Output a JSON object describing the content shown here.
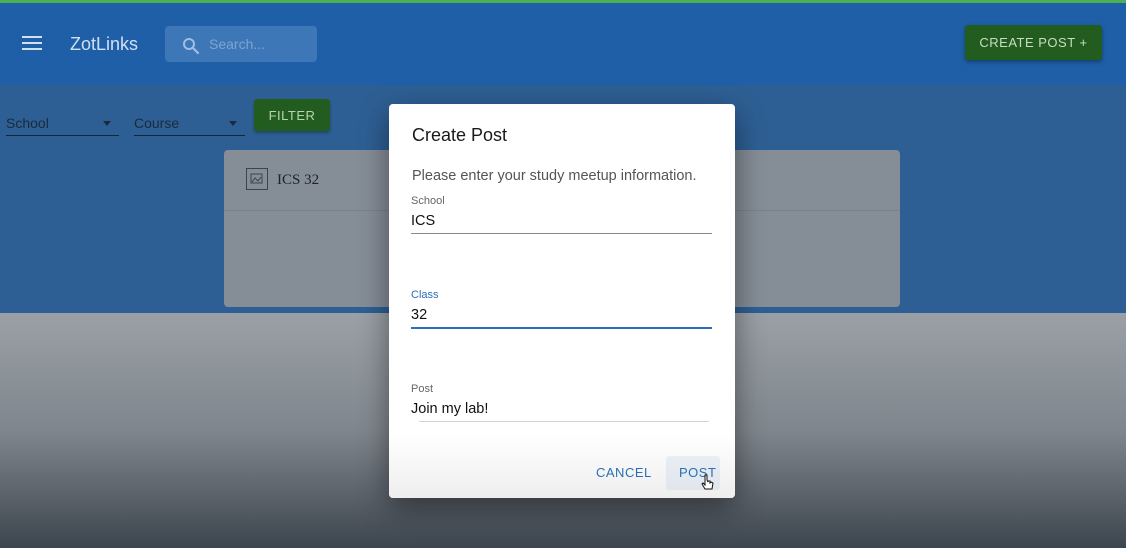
{
  "app": {
    "brand": "ZotLinks",
    "search_placeholder": "Search...",
    "create_post_label": "CREATE POST +"
  },
  "filters": {
    "school_label": "School",
    "course_label": "Course",
    "filter_label": "FILTER"
  },
  "card": {
    "title": "ICS 32"
  },
  "dialog": {
    "title": "Create Post",
    "text": "Please enter your study meetup information.",
    "school": {
      "label": "School",
      "value": "ICS"
    },
    "class_field": {
      "label": "Class",
      "value": "32"
    },
    "post": {
      "label": "Post",
      "value": "Join my lab!"
    },
    "cancel_label": "CANCEL",
    "post_label": "POST"
  },
  "colors": {
    "appbar": "#1f5fa8",
    "accent_green": "#235c1f",
    "focus_blue": "#2a6fb5"
  },
  "icons": [
    "menu-icon",
    "search-icon",
    "image-icon",
    "pointer-cursor-icon"
  ]
}
